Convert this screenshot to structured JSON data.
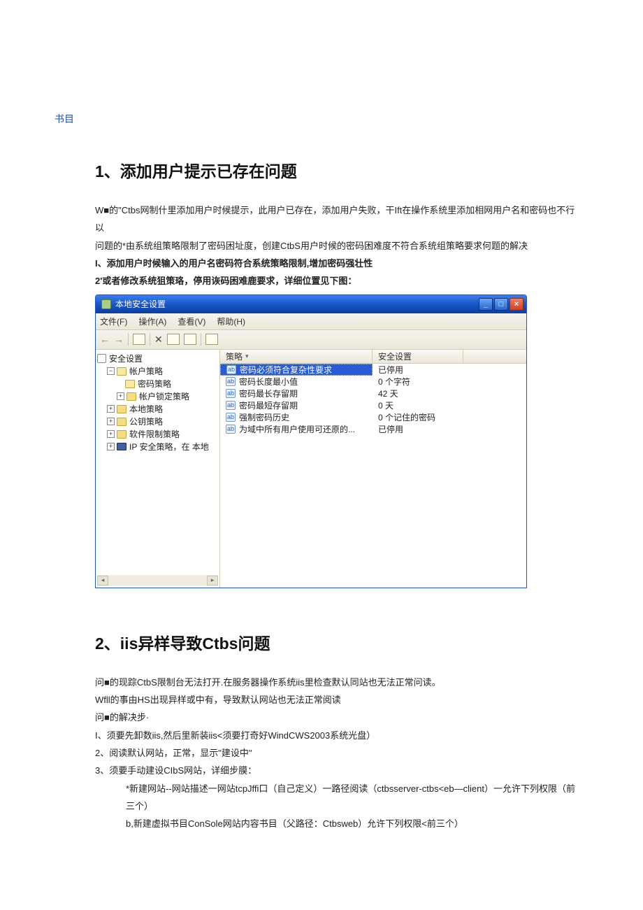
{
  "bookmark": "书目",
  "section1": {
    "title": "1、添加用户提示已存在问题",
    "p1": "W■的\"Ctbs网制什里添加用户时候提示，此用户已存在，添加用户失败，干Ift在操作系统里添加相网用户名和密码也不行以",
    "p2": "问题的*由系统组策略限制了密码困址度，创建CtbS用户时候的密码困难度不符合系统组策略要求何题的解决",
    "p3": "I、添加用户时候输入的用户名密码符合系统策略限制,增加密码强壮性",
    "p4": "2'或者修改系统狙策珞，停用诙码困难鹿要求，详细位置见下图："
  },
  "window": {
    "title": "本地安全设置",
    "menu": {
      "file": "文件(F)",
      "action": "操作(A)",
      "view": "查看(V)",
      "help": "帮助(H)"
    },
    "tree": {
      "root": "安全设置",
      "items": [
        "帐户策略",
        "密码策略",
        "帐户锁定策略",
        "本地策略",
        "公钥策略",
        "软件限制策略",
        "IP 安全策略，在 本地"
      ]
    },
    "list": {
      "headers": {
        "policy": "策略",
        "setting": "安全设置"
      },
      "rows": [
        {
          "policy": "密码必须符合复杂性要求",
          "setting": "已停用"
        },
        {
          "policy": "密码长度最小值",
          "setting": "0 个字符"
        },
        {
          "policy": "密码最长存留期",
          "setting": "42 天"
        },
        {
          "policy": "密码最短存留期",
          "setting": "0 天"
        },
        {
          "policy": "强制密码历史",
          "setting": "0 个记住的密码"
        },
        {
          "policy": "为域中所有用户使用可还原的...",
          "setting": "已停用"
        }
      ]
    }
  },
  "section2": {
    "title": "2、iis异样导致Ctbs问题",
    "p1": "问■的现踪CtbS限制台无法打开.在服务器操作系统iis里检查默认同站也无法正常问读。",
    "p2": "Wfll的事由HS出现异样或中有，导致默认网站也无法正常阅读",
    "p3": "问■的解决步·",
    "p4": "I、须要先卸数iis,然后里新装iis<须要打奇好WindCWS2003系统光盘）",
    "p5": "2、阅读默认网站，正常，显示\"建设中\"",
    "p6": "3、须要手动建设CIbS网站，详细步膜：",
    "p7": "*新建网站--网站描述一网站tcpJffi口（自己定义）一路径阅读（ctbsserver-ctbs<eb—client）一允许下列权限（前三个）",
    "p8": "b,新建虚拟书目ConSole网站内容书目（父路径：Ctbsweb）允许下列权限<前三个）"
  }
}
